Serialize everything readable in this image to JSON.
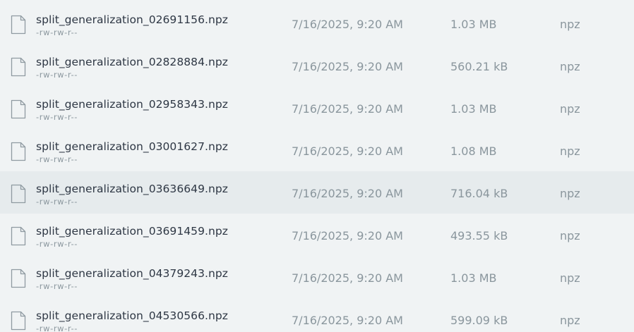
{
  "files": [
    {
      "name": "split_generalization_02691156.npz",
      "permissions": "-rw-rw-r--",
      "modified": "7/16/2025, 9:20 AM",
      "size": "1.03 MB",
      "type": "npz",
      "icon": "file-icon",
      "hovered": false
    },
    {
      "name": "split_generalization_02828884.npz",
      "permissions": "-rw-rw-r--",
      "modified": "7/16/2025, 9:20 AM",
      "size": "560.21 kB",
      "type": "npz",
      "icon": "file-icon",
      "hovered": false
    },
    {
      "name": "split_generalization_02958343.npz",
      "permissions": "-rw-rw-r--",
      "modified": "7/16/2025, 9:20 AM",
      "size": "1.03 MB",
      "type": "npz",
      "icon": "file-icon",
      "hovered": false
    },
    {
      "name": "split_generalization_03001627.npz",
      "permissions": "-rw-rw-r--",
      "modified": "7/16/2025, 9:20 AM",
      "size": "1.08 MB",
      "type": "npz",
      "icon": "file-icon",
      "hovered": false
    },
    {
      "name": "split_generalization_03636649.npz",
      "permissions": "-rw-rw-r--",
      "modified": "7/16/2025, 9:20 AM",
      "size": "716.04 kB",
      "type": "npz",
      "icon": "file-icon",
      "hovered": true
    },
    {
      "name": "split_generalization_03691459.npz",
      "permissions": "-rw-rw-r--",
      "modified": "7/16/2025, 9:20 AM",
      "size": "493.55 kB",
      "type": "npz",
      "icon": "file-icon",
      "hovered": false
    },
    {
      "name": "split_generalization_04379243.npz",
      "permissions": "-rw-rw-r--",
      "modified": "7/16/2025, 9:20 AM",
      "size": "1.03 MB",
      "type": "npz",
      "icon": "file-icon",
      "hovered": false
    },
    {
      "name": "split_generalization_04530566.npz",
      "permissions": "-rw-rw-r--",
      "modified": "7/16/2025, 9:20 AM",
      "size": "599.09 kB",
      "type": "npz",
      "icon": "file-icon",
      "hovered": false
    }
  ],
  "colors": {
    "background": "#f0f3f4",
    "row_hover": "#e6ebed",
    "name_text": "#2e3744",
    "meta_text": "#8a969d",
    "icon_stroke": "#8f9aa1"
  }
}
